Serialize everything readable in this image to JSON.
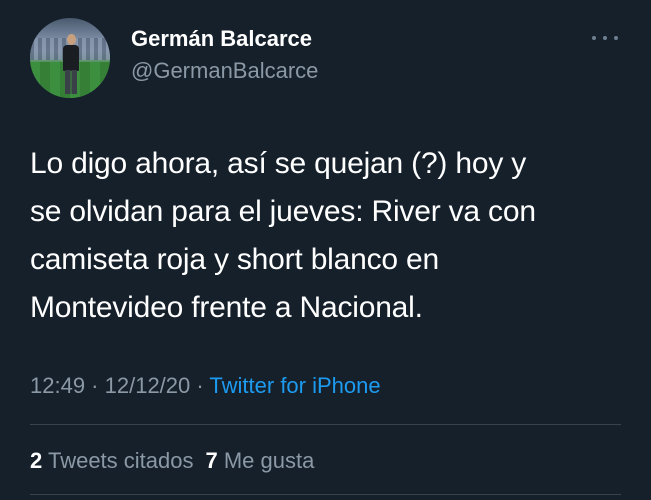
{
  "author": {
    "name": "Germán Balcarce",
    "handle": "@GermanBalcarce"
  },
  "tweet": {
    "lines": [
      "Lo digo ahora, así se quejan (?)  hoy y",
      "se olvidan para el jueves: River va con",
      "camiseta roja y short blanco en",
      "Montevideo frente a Nacional."
    ]
  },
  "meta": {
    "time": "12:49",
    "sep1": " · ",
    "date": "12/12/20",
    "sep2": " · ",
    "source": "Twitter for iPhone"
  },
  "stats": {
    "quotes_count": "2",
    "quotes_label": "Tweets citados",
    "likes_count": "7",
    "likes_label": "Me gusta"
  },
  "icons": {
    "more": "more-dots-icon"
  },
  "colors": {
    "background": "#15202b",
    "text": "#ffffff",
    "secondary": "#8b98a5",
    "link": "#1d9bf0",
    "divider": "#38444d"
  }
}
